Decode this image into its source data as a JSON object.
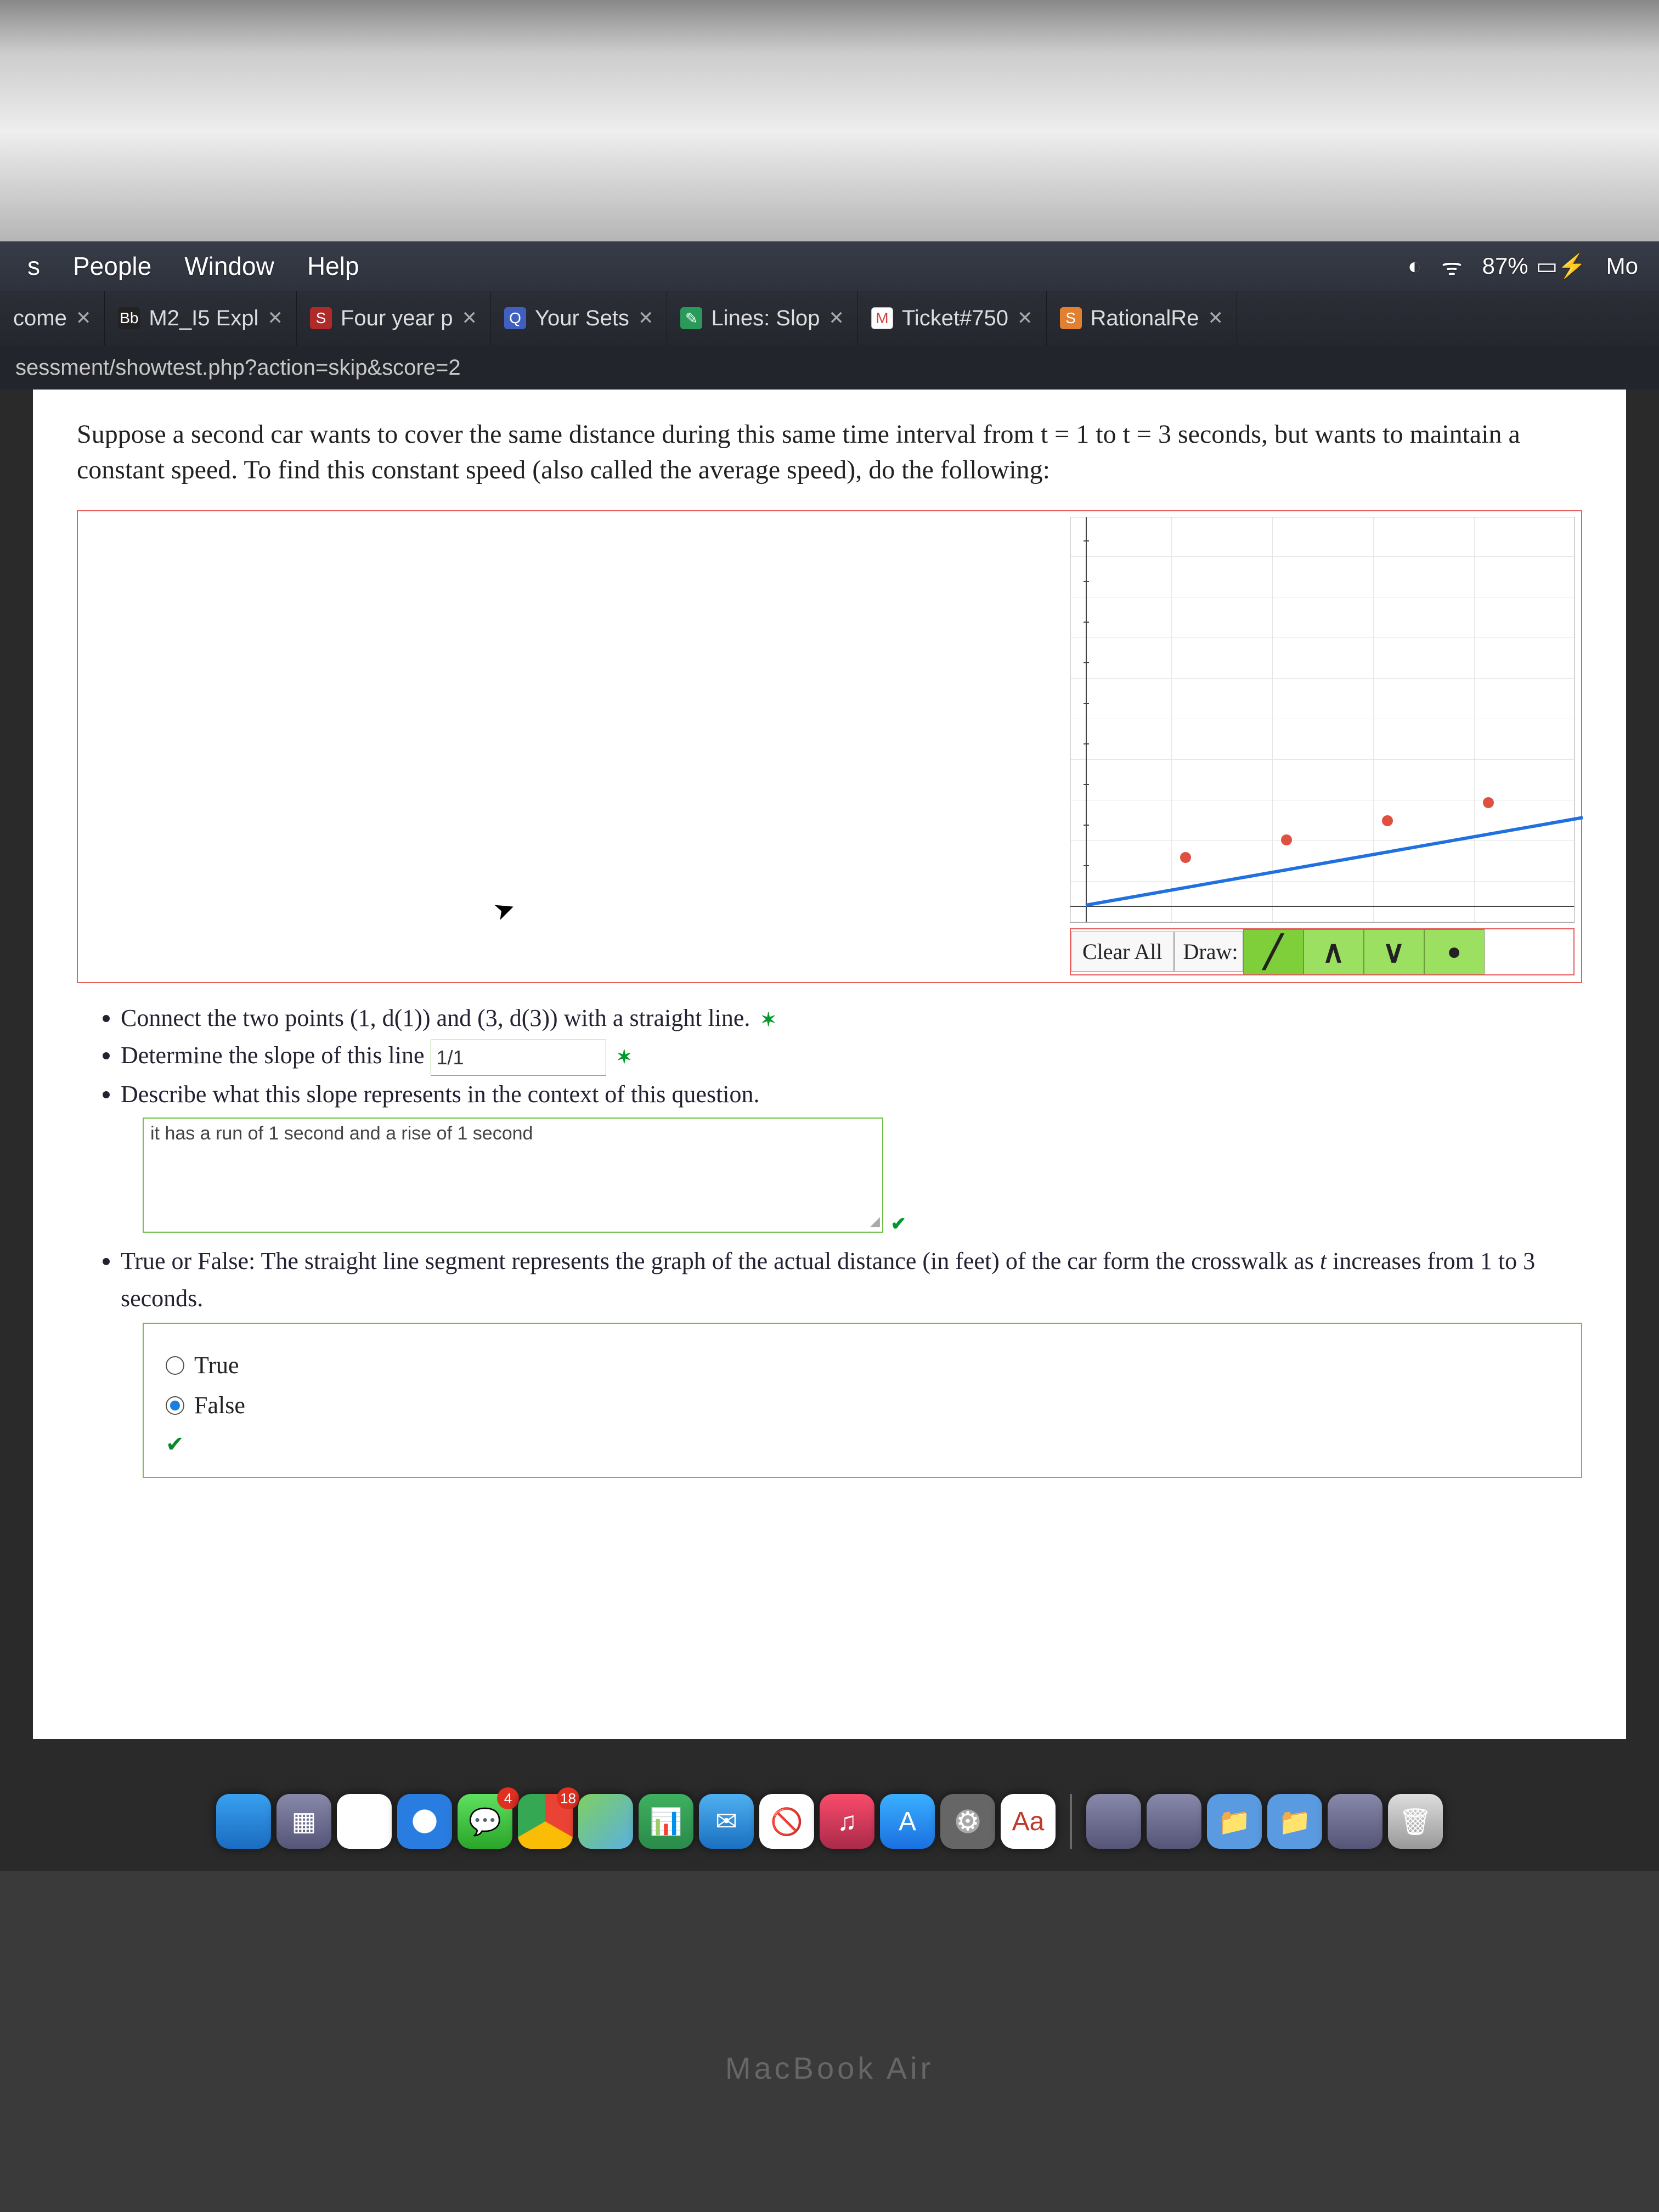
{
  "menubar": {
    "items": [
      "s",
      "People",
      "Window",
      "Help"
    ],
    "battery": "87%",
    "day": "Mo"
  },
  "tabs": [
    {
      "title": "come",
      "fav_bg": "#777",
      "fav_glyph": "",
      "show_close_left": true
    },
    {
      "title": "M2_I5 Expl",
      "fav_bg": "#222",
      "fav_glyph": "Bb",
      "fav_color": "#fff"
    },
    {
      "title": "Four year p",
      "fav_bg": "#b02a2a",
      "fav_glyph": "S",
      "fav_color": "#fff"
    },
    {
      "title": "Your Sets",
      "fav_bg": "#4060c0",
      "fav_glyph": "Q",
      "fav_color": "#fff"
    },
    {
      "title": "Lines: Slop",
      "fav_bg": "#2a9a5a",
      "fav_glyph": "✎",
      "fav_color": "#fff"
    },
    {
      "title": "Ticket#750",
      "fav_bg": "#fff",
      "fav_glyph": "M",
      "fav_color": "#d04040"
    },
    {
      "title": "RationalRe",
      "fav_bg": "#e08030",
      "fav_glyph": "S",
      "fav_color": "#fff"
    }
  ],
  "address_bar": "sessment/showtest.php?action=skip&score=2",
  "question": {
    "prompt": "Suppose a second car wants to cover the same distance during this same time interval from t = 1 to t = 3 seconds, but wants to maintain a constant speed. To find this constant speed (also called the average speed), do the following:",
    "bullet1": "Connect the two points (1, d(1)) and (3, d(3)) with a straight line.",
    "bullet2_pre": "Determine the slope of this line",
    "bullet3": "Describe what this slope represents in the context of this question.",
    "slope_input": "1/1",
    "describe_input": "it has a run of 1 second and a rise of 1 second",
    "bullet4_pre": "True or False: The straight line segment represents the graph of the actual distance (in feet) of the car form the crosswalk as ",
    "bullet4_var": "t",
    "bullet4_post": " increases from 1 to 3 seconds.",
    "opt_true": "True",
    "opt_false": "False",
    "selected": "false"
  },
  "graph_toolbar": {
    "clear": "Clear All",
    "draw": "Draw:"
  },
  "chart_data": {
    "type": "line",
    "title": "",
    "xlabel": "",
    "ylabel": "",
    "xlim": [
      0,
      5
    ],
    "ylim": [
      0,
      10
    ],
    "x": [
      1,
      2,
      3,
      4
    ],
    "y": [
      1,
      1.5,
      2,
      2.5
    ],
    "points_highlighted": [
      [
        1,
        1
      ],
      [
        2,
        1.5
      ],
      [
        3,
        2
      ],
      [
        4,
        2.5
      ]
    ]
  },
  "dock": {
    "items": [
      {
        "name": "finder",
        "cls": "finder"
      },
      {
        "name": "launchpad",
        "cls": ""
      },
      {
        "name": "photos",
        "cls": "photos"
      },
      {
        "name": "safari",
        "cls": "safari",
        "badge": ""
      },
      {
        "name": "messages",
        "cls": "msgs",
        "badge": "4"
      },
      {
        "name": "chrome",
        "cls": "chrome",
        "badge": "18"
      },
      {
        "name": "maps",
        "cls": "maps"
      },
      {
        "name": "numbers",
        "cls": "numbers",
        "glyph": "📊"
      },
      {
        "name": "mail",
        "cls": "mail",
        "glyph": "✉"
      },
      {
        "name": "nope",
        "cls": "",
        "glyph": "🚫"
      },
      {
        "name": "music",
        "cls": "music",
        "glyph": "♫"
      },
      {
        "name": "appstore",
        "cls": "appstore",
        "glyph": "A"
      },
      {
        "name": "preferences",
        "cls": "sys",
        "glyph": "⚙"
      },
      {
        "name": "dictionary",
        "cls": "dict",
        "glyph": "Aa"
      }
    ],
    "right": [
      {
        "name": "downloads",
        "cls": "",
        "glyph": ""
      },
      {
        "name": "downloads2",
        "cls": "",
        "glyph": ""
      },
      {
        "name": "folder",
        "cls": "",
        "glyph": "📁"
      },
      {
        "name": "folder2",
        "cls": "",
        "glyph": "📁"
      },
      {
        "name": "unknown",
        "cls": "",
        "glyph": ""
      },
      {
        "name": "trash",
        "cls": "trash",
        "glyph": "🗑"
      }
    ]
  },
  "macbook": "MacBook Air"
}
